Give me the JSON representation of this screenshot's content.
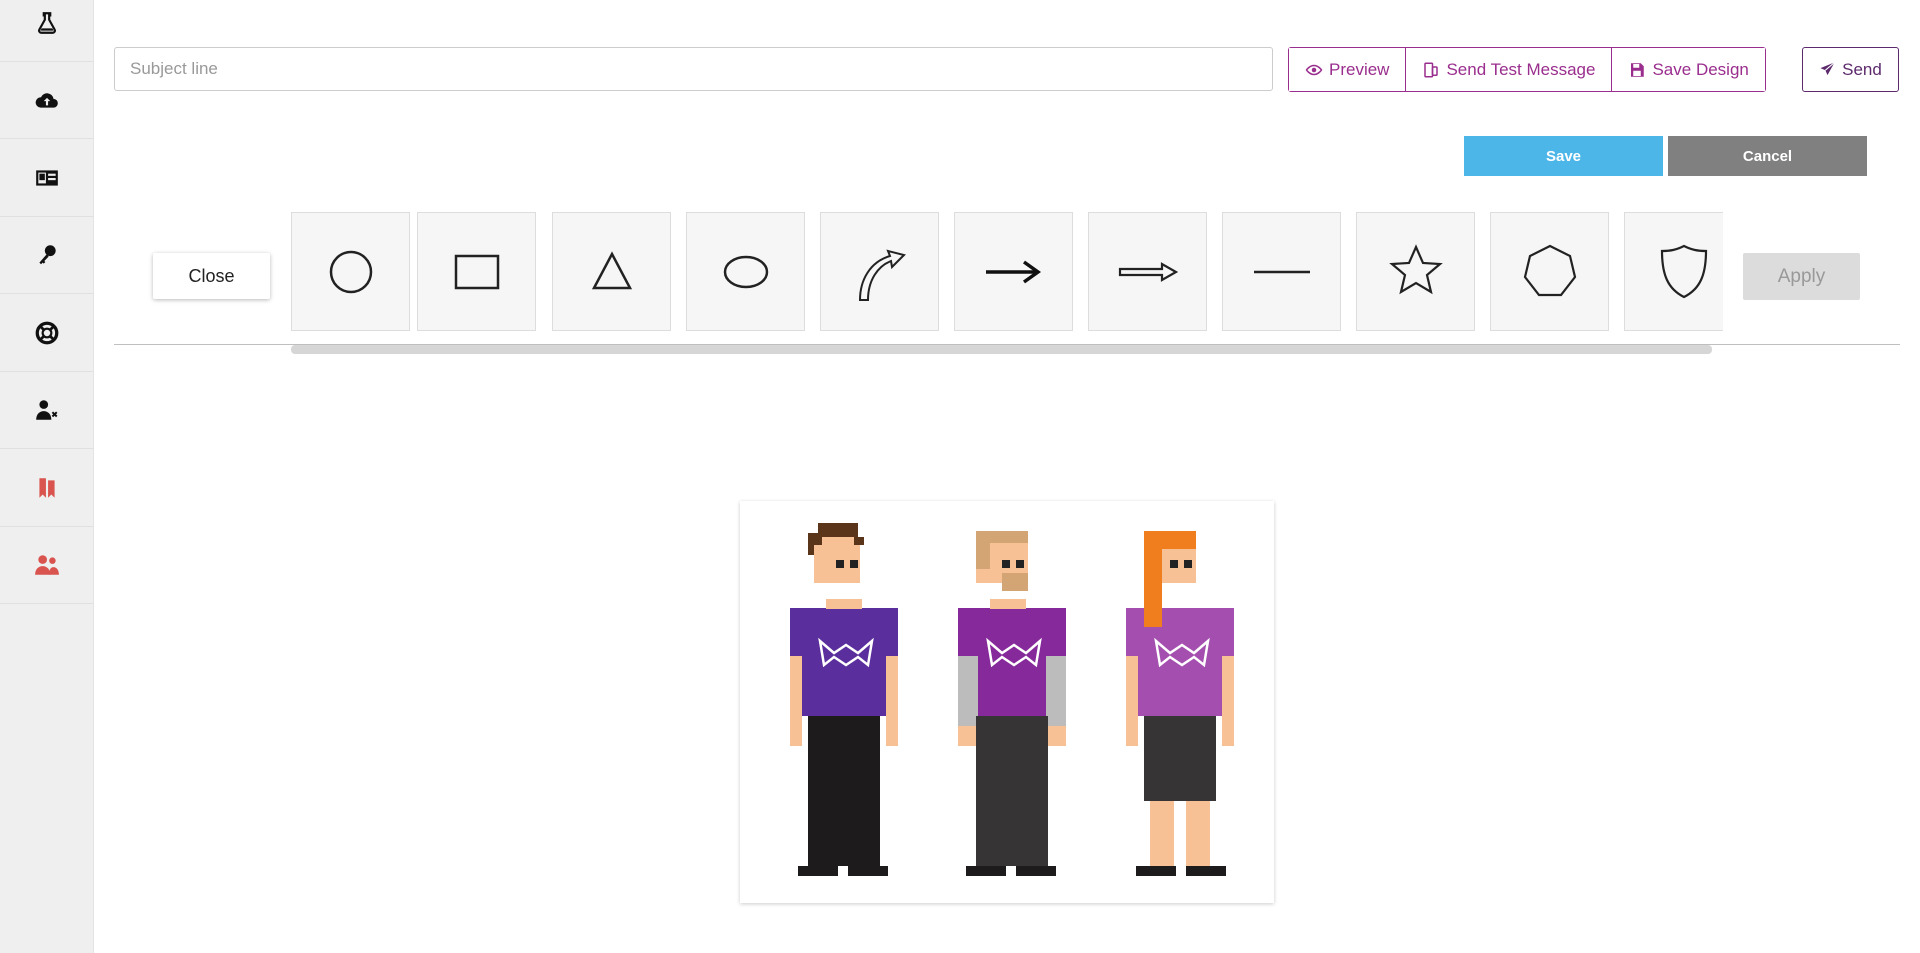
{
  "sidebar": {
    "items": [
      {
        "icon": "flask-icon"
      },
      {
        "icon": "cloud-upload-icon"
      },
      {
        "icon": "id-card-icon"
      },
      {
        "icon": "key-icon"
      },
      {
        "icon": "lifebuoy-icon"
      },
      {
        "icon": "user-remove-icon"
      },
      {
        "icon": "bookmark-icon",
        "color": "#d9534f"
      },
      {
        "icon": "users-icon",
        "color": "#d9534f"
      }
    ]
  },
  "email": {
    "subject_value": "",
    "subject_placeholder": "Subject line"
  },
  "toolbar": {
    "preview_label": "Preview",
    "test_label": "Send Test Message",
    "save_design_label": "Save Design",
    "send_label": "Send",
    "accent_color": "#9a2e8e"
  },
  "editor": {
    "save_label": "Save",
    "cancel_label": "Cancel",
    "close_label": "Close",
    "apply_label": "Apply",
    "save_color": "#4db6e8",
    "cancel_color": "#808080"
  },
  "shapes": [
    {
      "name": "circle"
    },
    {
      "name": "rectangle"
    },
    {
      "name": "triangle"
    },
    {
      "name": "ellipse"
    },
    {
      "name": "curved-arrow"
    },
    {
      "name": "arrow"
    },
    {
      "name": "double-line-arrow"
    },
    {
      "name": "line"
    },
    {
      "name": "star"
    },
    {
      "name": "heptagon"
    },
    {
      "name": "shield"
    }
  ],
  "image": {
    "description_icon": "team-pixel-art-image",
    "shirt_colors": [
      "#5a2e9c",
      "#86299a",
      "#a44eaf"
    ]
  }
}
